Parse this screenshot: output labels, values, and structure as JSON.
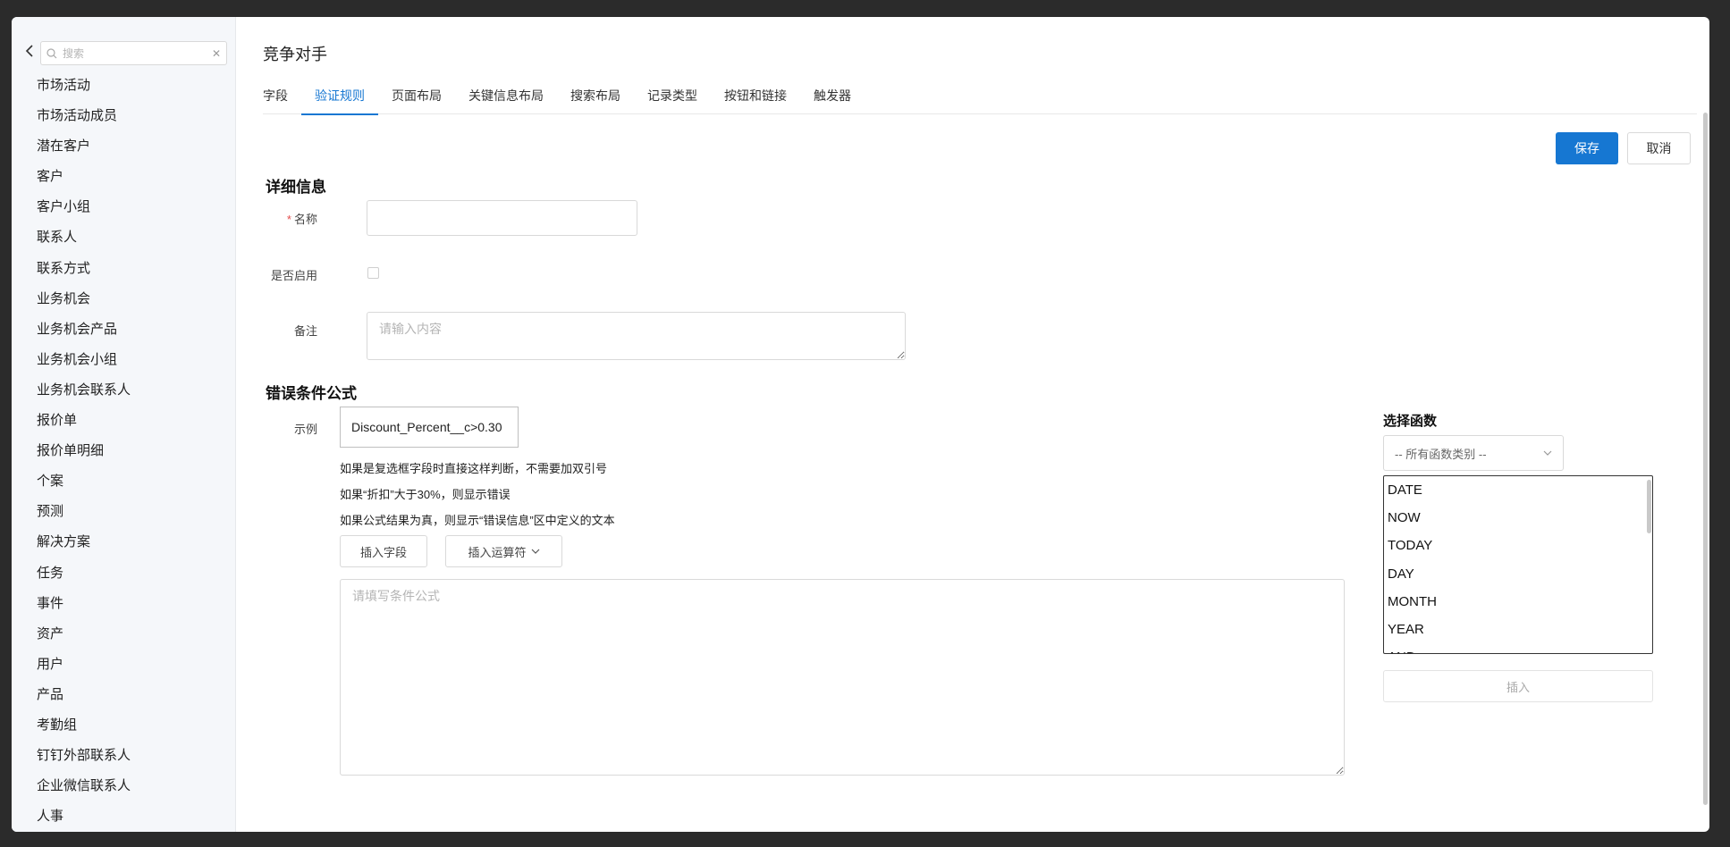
{
  "sidebar": {
    "search_placeholder": "搜索",
    "items": [
      "市场活动",
      "市场活动成员",
      "潜在客户",
      "客户",
      "客户小组",
      "联系人",
      "联系方式",
      "业务机会",
      "业务机会产品",
      "业务机会小组",
      "业务机会联系人",
      "报价单",
      "报价单明细",
      "个案",
      "预测",
      "解决方案",
      "任务",
      "事件",
      "资产",
      "用户",
      "产品",
      "考勤组",
      "钉钉外部联系人",
      "企业微信联系人",
      "人事"
    ]
  },
  "header": {
    "title": "竞争对手",
    "tabs": [
      "字段",
      "验证规则",
      "页面布局",
      "关键信息布局",
      "搜索布局",
      "记录类型",
      "按钮和链接",
      "触发器"
    ],
    "active_tab": 1
  },
  "actions": {
    "save": "保存",
    "cancel": "取消"
  },
  "details": {
    "title": "详细信息",
    "name_label": "名称",
    "name_value": "",
    "enabled_label": "是否启用",
    "remark_label": "备注",
    "remark_placeholder": "请输入内容"
  },
  "formula": {
    "title": "错误条件公式",
    "example_label": "示例",
    "example_value": "Discount_Percent__c>0.30",
    "hints": [
      "如果是复选框字段时直接这样判断，不需要加双引号",
      "如果“折扣”大于30%，则显示错误",
      "如果公式结果为真，则显示“错误信息”区中定义的文本"
    ],
    "insert_field": "插入字段",
    "insert_operator": "插入运算符",
    "editor_placeholder": "请填写条件公式"
  },
  "functions": {
    "title": "选择函数",
    "category_selected": "-- 所有函数类别 --",
    "list": [
      "DATE",
      "NOW",
      "TODAY",
      "DAY",
      "MONTH",
      "YEAR",
      "AND"
    ],
    "insert": "插入"
  },
  "colors": {
    "accent": "#1677d2",
    "required": "#e34d4d"
  }
}
